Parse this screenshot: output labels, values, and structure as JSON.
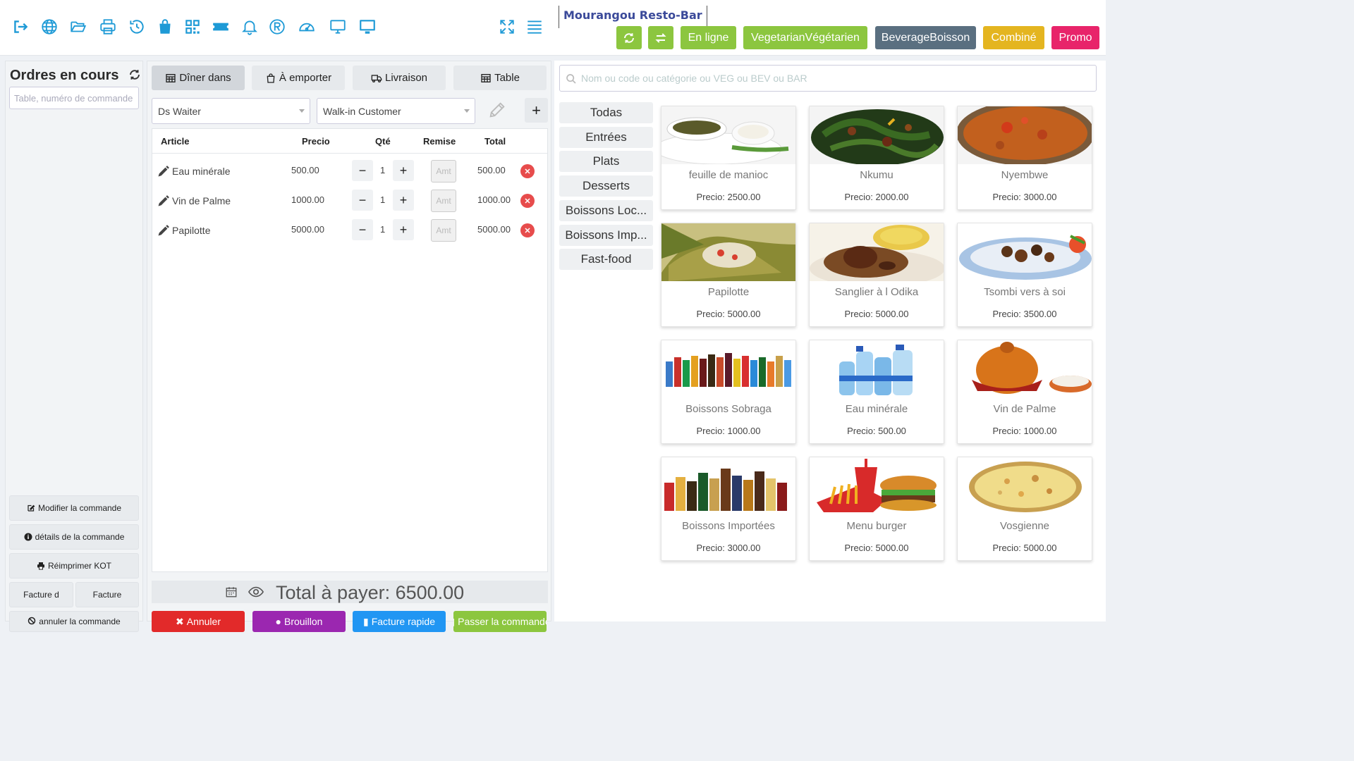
{
  "colors": {
    "primary": "#1e9ad6",
    "green": "#8cc63f",
    "slate": "#5a6f80",
    "amber": "#e4b520",
    "pink": "#e8246a",
    "red": "#e22a2a",
    "purple": "#9b27b0",
    "blue": "#2196f3"
  },
  "toolbar": {
    "icons": [
      "sign-out-icon",
      "globe-icon",
      "folder-open-icon",
      "printer-icon",
      "history-icon",
      "shopping-bag-icon",
      "qr-code-icon",
      "ticket-icon",
      "bell-icon",
      "registered-icon",
      "speedometer-icon",
      "desktop-icon",
      "monitor-icon"
    ],
    "right_icons": [
      "expand-icon",
      "menu-icon"
    ],
    "brand": "Mourangou Resto-Bar",
    "buttons": [
      {
        "label": "",
        "icon": "refresh-icon",
        "color": "#8cc63f"
      },
      {
        "label": "",
        "icon": "exchange-icon",
        "color": "#8cc63f"
      },
      {
        "label": "En ligne",
        "color": "#8cc63f"
      },
      {
        "label": "VegetarianVégétarien",
        "color": "#8cc63f"
      },
      {
        "label": "BeverageBoisson",
        "color": "#5a6f80"
      },
      {
        "label": "Combiné",
        "color": "#e4b520"
      },
      {
        "label": "Promo",
        "color": "#e8246a"
      }
    ]
  },
  "orders_panel": {
    "title": "Ordres en cours",
    "search_placeholder": "Table, numéro de commande",
    "buttons": {
      "modify": "Modifier la commande",
      "details": "détails de la commande",
      "reprint": "Réimprimer KOT",
      "invoice_d": "Facture d",
      "invoice": "Facture",
      "cancel_order": "annuler la commande"
    }
  },
  "order": {
    "tabs": [
      {
        "label": "Dîner dans",
        "icon": "table-icon",
        "active": true
      },
      {
        "label": "À emporter",
        "icon": "bag-icon",
        "active": false
      },
      {
        "label": "Livraison",
        "icon": "truck-icon",
        "active": false
      },
      {
        "label": "Table",
        "icon": "table-icon",
        "active": false
      }
    ],
    "waiter": "Ds Waiter",
    "customer": "Walk-in Customer",
    "columns": {
      "article": "Article",
      "price": "Precio",
      "qty": "Qté",
      "discount": "Remise",
      "total": "Total"
    },
    "amt_placeholder": "Amt",
    "items": [
      {
        "name": "Eau minérale",
        "price": "500.00",
        "qty": "1",
        "total": "500.00"
      },
      {
        "name": "Vin de Palme",
        "price": "1000.00",
        "qty": "1",
        "total": "1000.00"
      },
      {
        "name": "Papilotte",
        "price": "5000.00",
        "qty": "1",
        "total": "5000.00"
      }
    ],
    "total_label": "Total à payer: 6500.00",
    "actions": {
      "cancel": "Annuler",
      "draft": "Brouillon",
      "quick_invoice": "Facture rapide",
      "place_order": "Passer la commande"
    }
  },
  "catalog": {
    "search_placeholder": "Nom ou code ou catégorie ou VEG ou BEV ou BAR",
    "categories": [
      "Todas",
      "Entrées",
      "Plats",
      "Desserts",
      "Boissons Loc...",
      "Boissons Imp...",
      "Fast-food"
    ],
    "products": [
      {
        "name": "feuille de manioc",
        "price": "Precio: 2500.00"
      },
      {
        "name": "Nkumu",
        "price": "Precio: 2000.00"
      },
      {
        "name": "Nyembwe",
        "price": "Precio: 3000.00"
      },
      {
        "name": "Papilotte",
        "price": "Precio: 5000.00"
      },
      {
        "name": "Sanglier à l Odika",
        "price": "Precio: 5000.00"
      },
      {
        "name": "Tsombi vers à soi",
        "price": "Precio: 3500.00"
      },
      {
        "name": "Boissons Sobraga",
        "price": "Precio: 1000.00"
      },
      {
        "name": "Eau minérale",
        "price": "Precio: 500.00"
      },
      {
        "name": "Vin de Palme",
        "price": "Precio: 1000.00"
      },
      {
        "name": "Boissons Importées",
        "price": "Precio: 3000.00"
      },
      {
        "name": "Menu burger",
        "price": "Precio: 5000.00"
      },
      {
        "name": "Vosgienne",
        "price": "Precio: 5000.00"
      }
    ]
  }
}
